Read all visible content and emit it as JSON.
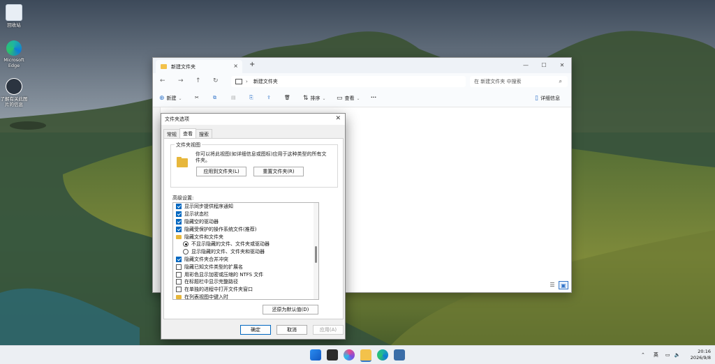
{
  "desktop": {
    "icons": [
      {
        "label": "回收站"
      },
      {
        "label": "Microsoft Edge"
      },
      {
        "label": "了解有关此图片的信息"
      }
    ]
  },
  "explorer": {
    "tab_title": "新建文件夹",
    "tab_close": "×",
    "new_tab": "+",
    "window_controls": {
      "minimize": "—",
      "maximize": "☐",
      "close": "✕"
    },
    "address": "新建文件夹",
    "search_placeholder": "在 新建文件夹 中搜索",
    "toolbar": {
      "new_label": "新建",
      "sort_label": "排序",
      "view_label": "查看",
      "more_label": "···",
      "details_label": "详细信息"
    }
  },
  "dialog": {
    "title": "文件夹选项",
    "close": "✕",
    "tabs": [
      "常规",
      "查看",
      "搜索"
    ],
    "active_tab": 1,
    "folder_views": {
      "title": "文件夹视图",
      "description": "你可以将此视图(如详细信息或图标)应用于这种类型的所有文件夹。",
      "apply_button": "应用到文件夹(L)",
      "reset_button": "重置文件夹(R)"
    },
    "advanced_label": "高级设置:",
    "advanced_items": [
      {
        "type": "checkbox",
        "checked": true,
        "label": "显示同步提供程序通知"
      },
      {
        "type": "checkbox",
        "checked": true,
        "label": "显示状态栏"
      },
      {
        "type": "checkbox",
        "checked": true,
        "label": "隐藏空的驱动器"
      },
      {
        "type": "checkbox",
        "checked": true,
        "label": "隐藏受保护的操作系统文件(推荐)"
      },
      {
        "type": "folder",
        "label": "隐藏文件和文件夹"
      },
      {
        "type": "radio",
        "checked": true,
        "label": "不显示隐藏的文件、文件夹或驱动器"
      },
      {
        "type": "radio",
        "checked": false,
        "label": "显示隐藏的文件、文件夹和驱动器"
      },
      {
        "type": "checkbox",
        "checked": true,
        "label": "隐藏文件夹合并冲突"
      },
      {
        "type": "checkbox",
        "checked": false,
        "label": "隐藏已知文件类型的扩展名"
      },
      {
        "type": "checkbox",
        "checked": false,
        "label": "用彩色显示加密或压缩的 NTFS 文件"
      },
      {
        "type": "checkbox",
        "checked": false,
        "label": "在标题栏中显示完整路径"
      },
      {
        "type": "checkbox",
        "checked": false,
        "label": "在单独的进程中打开文件夹窗口"
      },
      {
        "type": "folder",
        "label": "在列表视图中键入时"
      }
    ],
    "restore_defaults": "还原为默认值(D)",
    "ok": "确定",
    "cancel": "取消",
    "apply": "应用(A)"
  },
  "taskbar": {
    "ime": "英",
    "date_time": {
      "time": "20:16",
      "date": "2026/9/8"
    }
  },
  "colors": {
    "accent": "#0067c0",
    "folder": "#e7b73c"
  }
}
